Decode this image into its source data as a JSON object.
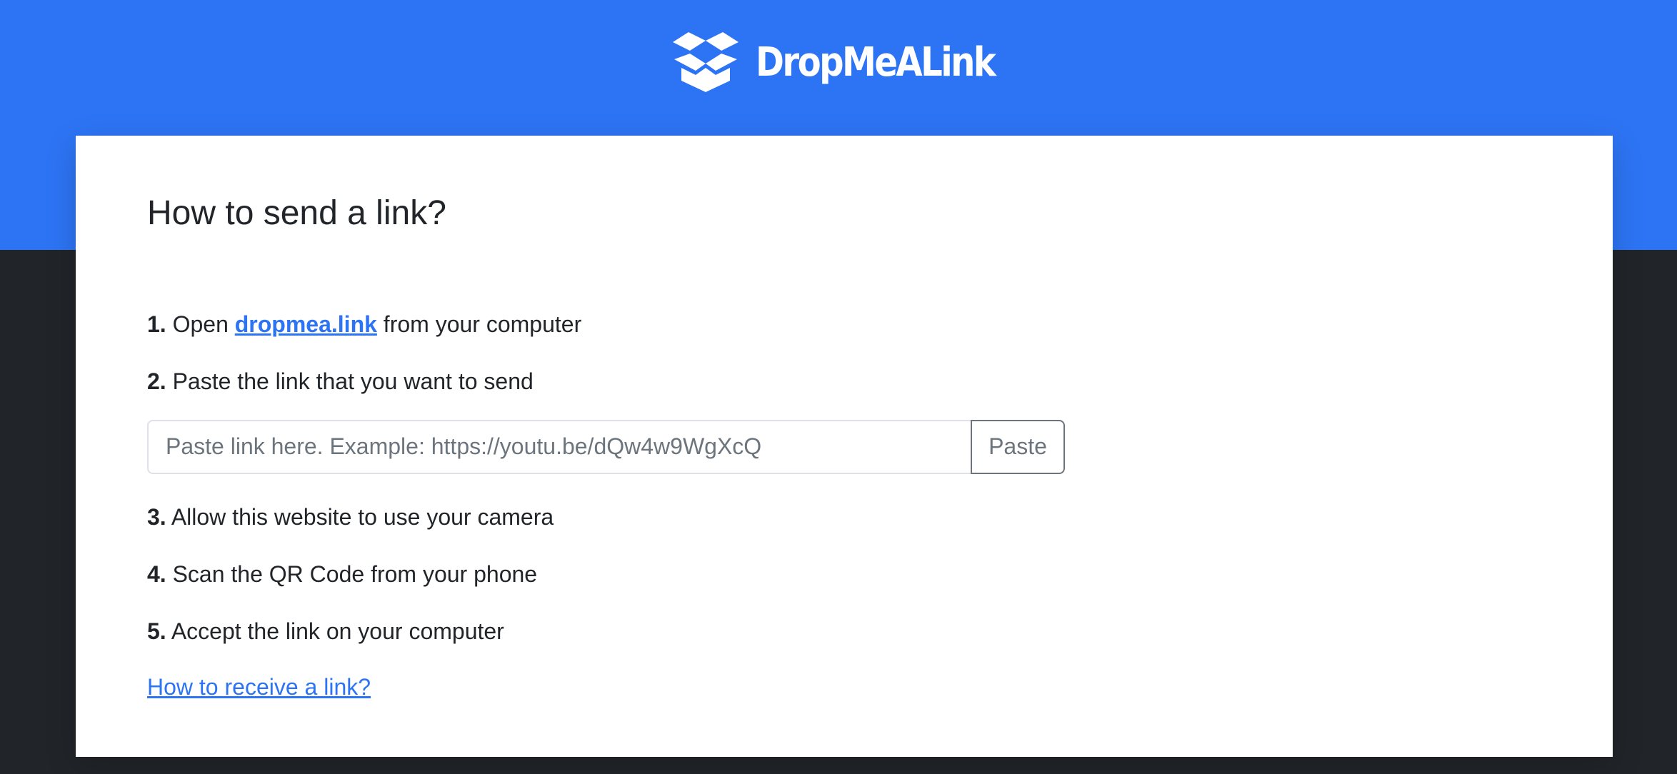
{
  "header": {
    "brand": "DropMeALink",
    "logo_icon": "open-box-icon",
    "color": "#2d74f4"
  },
  "main": {
    "title": "How to send a link?",
    "steps": [
      {
        "num": "1.",
        "pre": "Open ",
        "link": "dropmea.link",
        "post": " from your computer"
      },
      {
        "num": "2.",
        "text": "Paste the link that you want to send"
      },
      {
        "num": "3.",
        "text": "Allow this website to use your camera"
      },
      {
        "num": "4.",
        "text": "Scan the QR Code from your phone"
      },
      {
        "num": "5.",
        "text": "Accept the link on your computer"
      }
    ],
    "input": {
      "placeholder": "Paste link here. Example: https://youtu.be/dQw4w9WgXcQ",
      "value": ""
    },
    "paste_label": "Paste",
    "receive_link": "How to receive a link?"
  }
}
